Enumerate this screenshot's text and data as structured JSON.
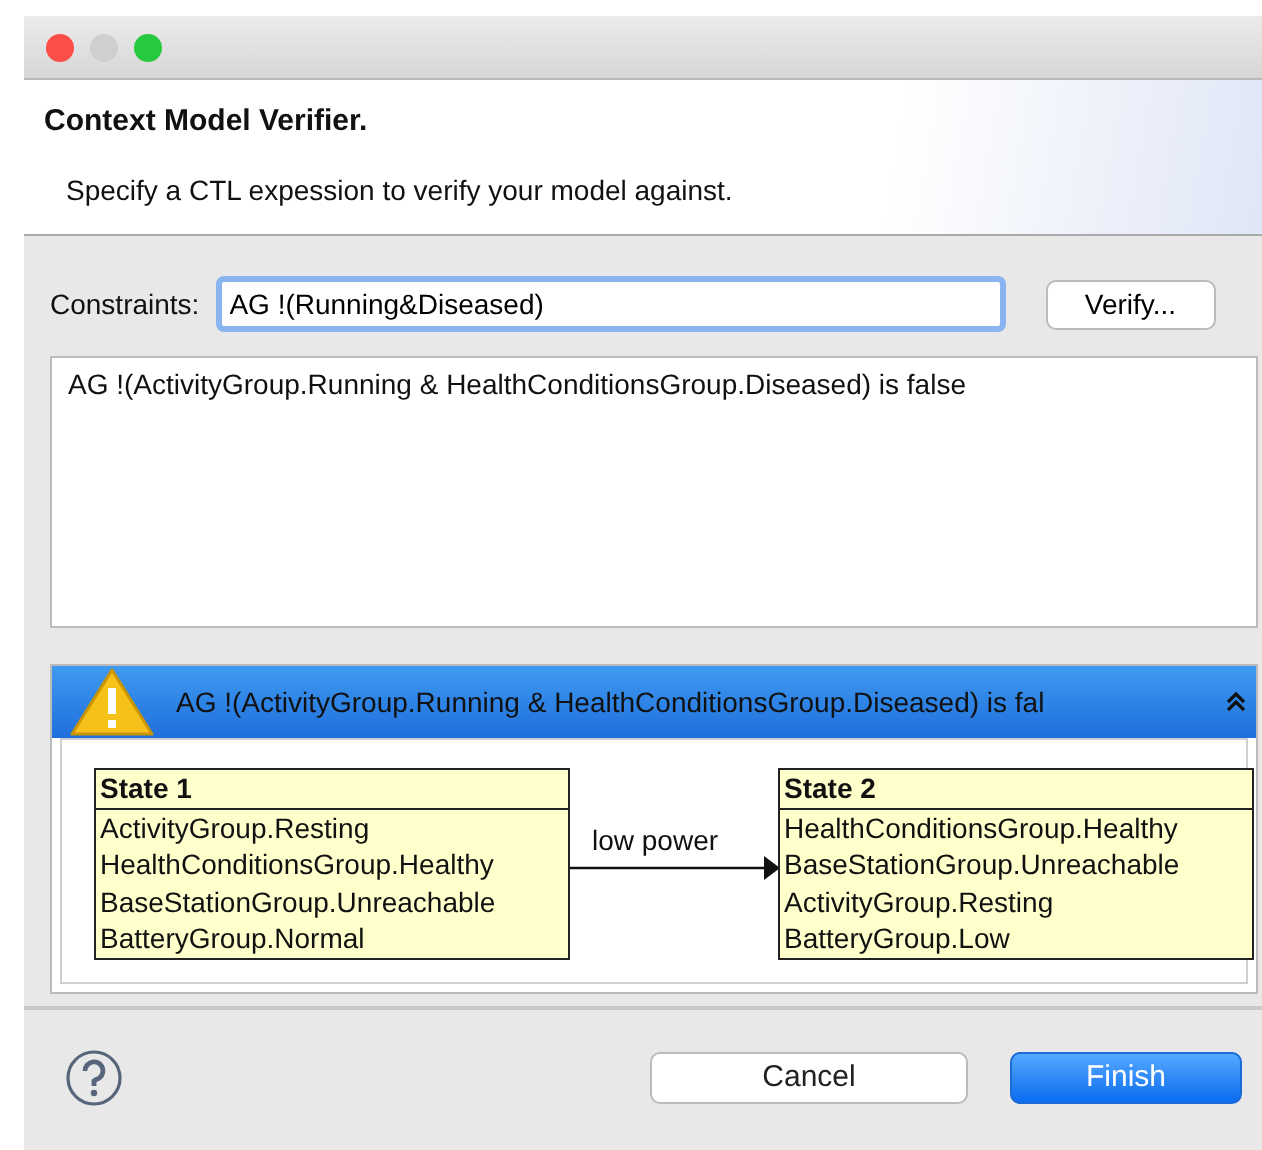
{
  "window": {
    "title": "Context Model Verifier.",
    "subtitle": "Specify a CTL expession to verify your model against."
  },
  "constraints": {
    "label": "Constraints:",
    "value": "AG !(Running&Diseased)",
    "button": "Verify..."
  },
  "output": "AG !(ActivityGroup.Running & HealthConditionsGroup.Diseased)  is false",
  "result": {
    "message": "AG !(ActivityGroup.Running & HealthConditionsGroup.Diseased)  is fal",
    "states": [
      {
        "title": "State 1",
        "lines": [
          "ActivityGroup.Resting",
          "HealthConditionsGroup.Healthy",
          "BaseStationGroup.Unreachable",
          "BatteryGroup.Normal"
        ]
      },
      {
        "title": "State 2",
        "lines": [
          "HealthConditionsGroup.Healthy",
          "BaseStationGroup.Unreachable",
          "ActivityGroup.Resting",
          "BatteryGroup.Low"
        ]
      }
    ],
    "transition": "low power"
  },
  "buttons": [
    {
      "label": "Cancel",
      "kind": "secondary"
    },
    {
      "label": "Finish",
      "kind": "primary"
    }
  ]
}
